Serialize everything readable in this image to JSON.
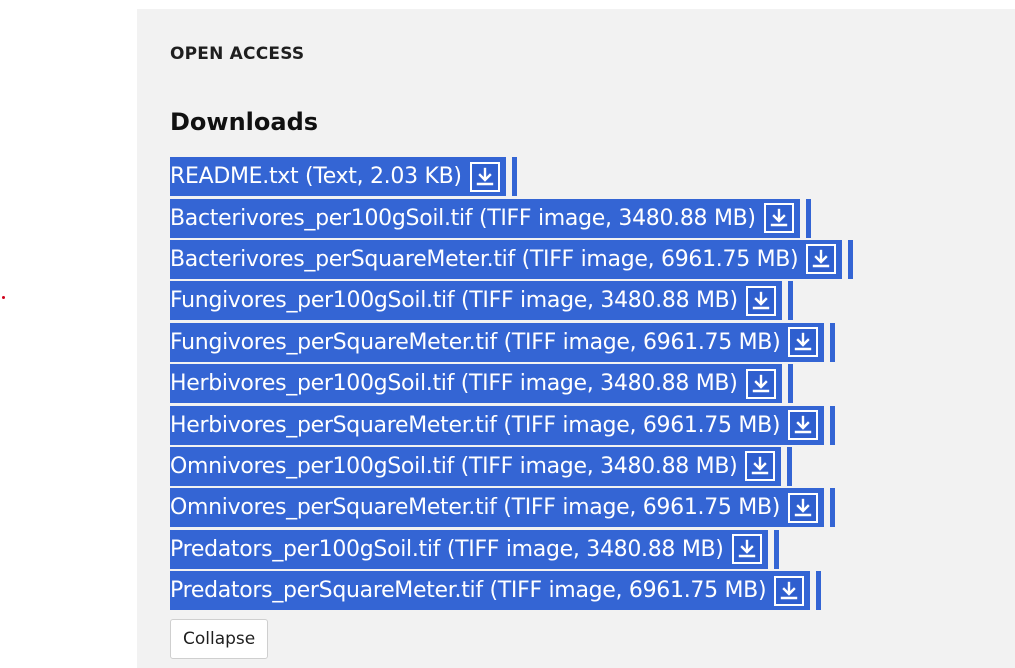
{
  "section": {
    "access_label": "OPEN ACCESS",
    "heading": "Downloads"
  },
  "files": [
    {
      "label": "README.txt (Text, 2.03 KB)",
      "download_icon": "download-icon"
    },
    {
      "label": "Bacterivores_per100gSoil.tif (TIFF image, 3480.88 MB)",
      "download_icon": "download-icon"
    },
    {
      "label": "Bacterivores_perSquareMeter.tif (TIFF image, 6961.75 MB)",
      "download_icon": "download-icon"
    },
    {
      "label": "Fungivores_per100gSoil.tif (TIFF image, 3480.88 MB)",
      "download_icon": "download-icon"
    },
    {
      "label": "Fungivores_perSquareMeter.tif (TIFF image, 6961.75 MB)",
      "download_icon": "download-icon"
    },
    {
      "label": "Herbivores_per100gSoil.tif (TIFF image, 3480.88 MB)",
      "download_icon": "download-icon"
    },
    {
      "label": "Herbivores_perSquareMeter.tif (TIFF image, 6961.75 MB)",
      "download_icon": "download-icon"
    },
    {
      "label": "Omnivores_per100gSoil.tif (TIFF image, 3480.88 MB)",
      "download_icon": "download-icon"
    },
    {
      "label": "Omnivores_perSquareMeter.tif (TIFF image, 6961.75 MB)",
      "download_icon": "download-icon"
    },
    {
      "label": "Predators_per100gSoil.tif (TIFF image, 3480.88 MB)",
      "download_icon": "download-icon"
    },
    {
      "label": "Predators_perSquareMeter.tif (TIFF image, 6961.75 MB)",
      "download_icon": "download-icon"
    }
  ],
  "collapse_label": "Collapse",
  "colors": {
    "selection": "#3465d4",
    "panel_background": "#f2f2f2",
    "marker_dot": "#d0021b"
  }
}
